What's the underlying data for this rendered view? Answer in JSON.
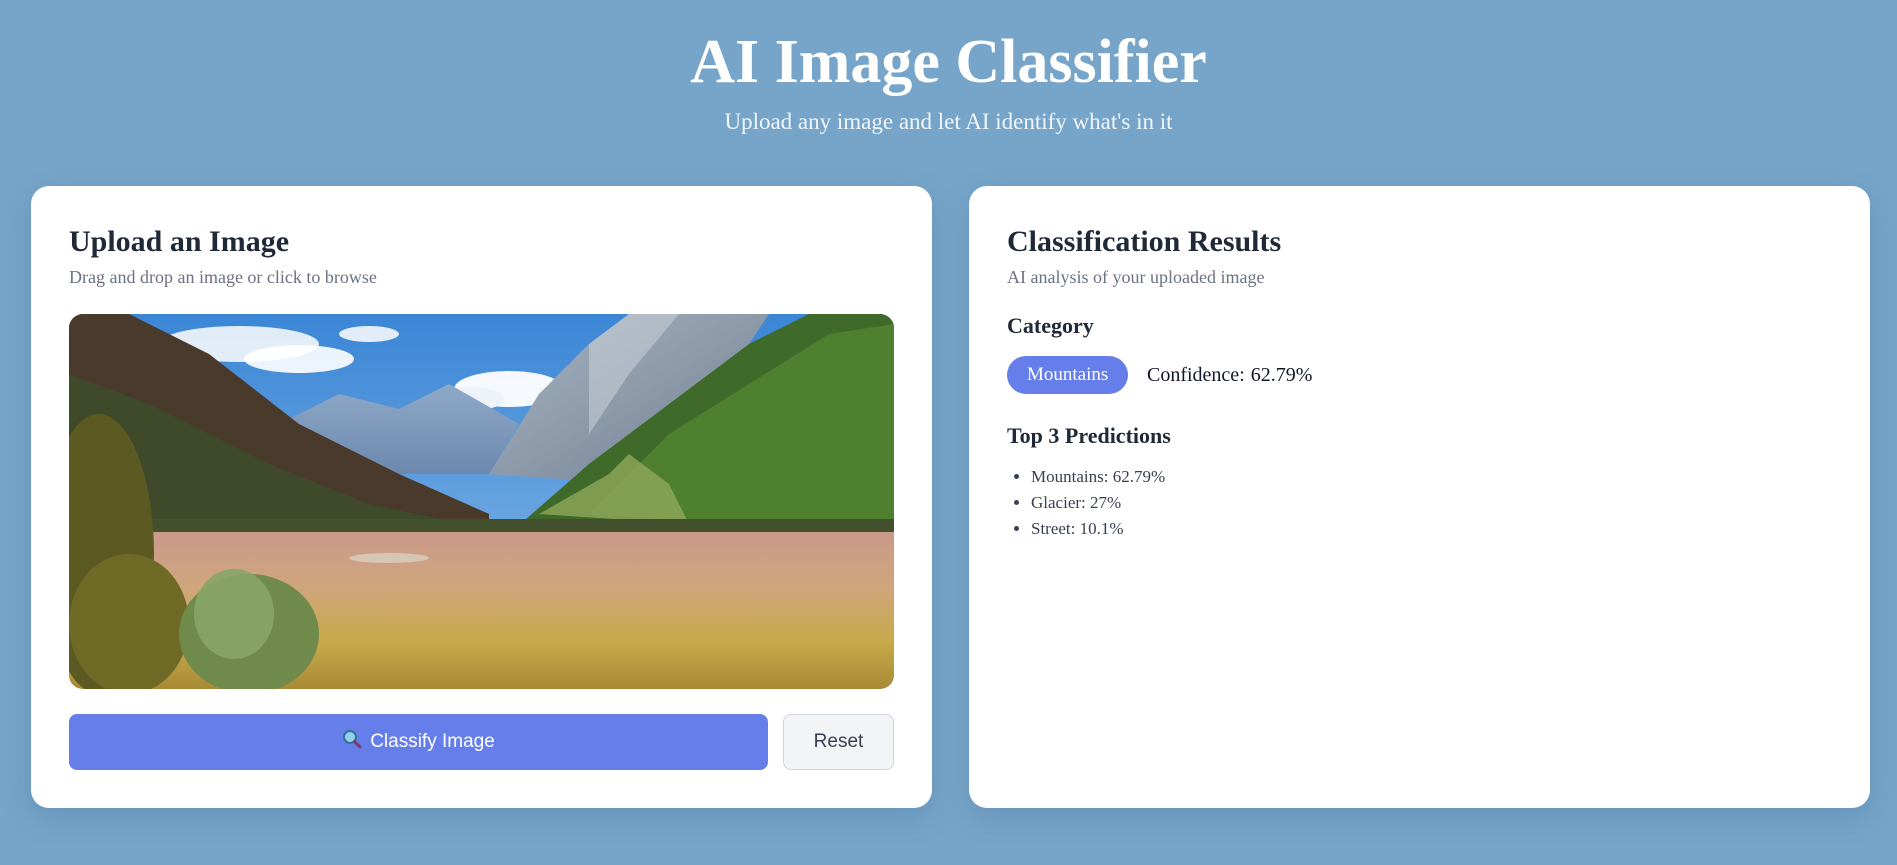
{
  "header": {
    "title": "AI Image Classifier",
    "subtitle": "Upload any image and let AI identify what's in it"
  },
  "upload": {
    "title": "Upload an Image",
    "description": "Drag and drop an image or click to browse",
    "preview_icon": "uploaded-image-preview",
    "classify_icon": "magnifier-icon",
    "classify_label": "Classify Image",
    "reset_label": "Reset"
  },
  "results": {
    "title": "Classification Results",
    "description": "AI analysis of your uploaded image",
    "category_heading": "Category",
    "category_value": "Mountains",
    "confidence_label": "Confidence:",
    "confidence_value": "62.79%",
    "predictions_heading": "Top 3 Predictions",
    "predictions": [
      "Mountains: 62.79%",
      "Glacier: 27%",
      "Street: 10.1%"
    ]
  },
  "colors": {
    "background": "#76a5c9",
    "accent": "#667eea",
    "card": "#ffffff"
  }
}
